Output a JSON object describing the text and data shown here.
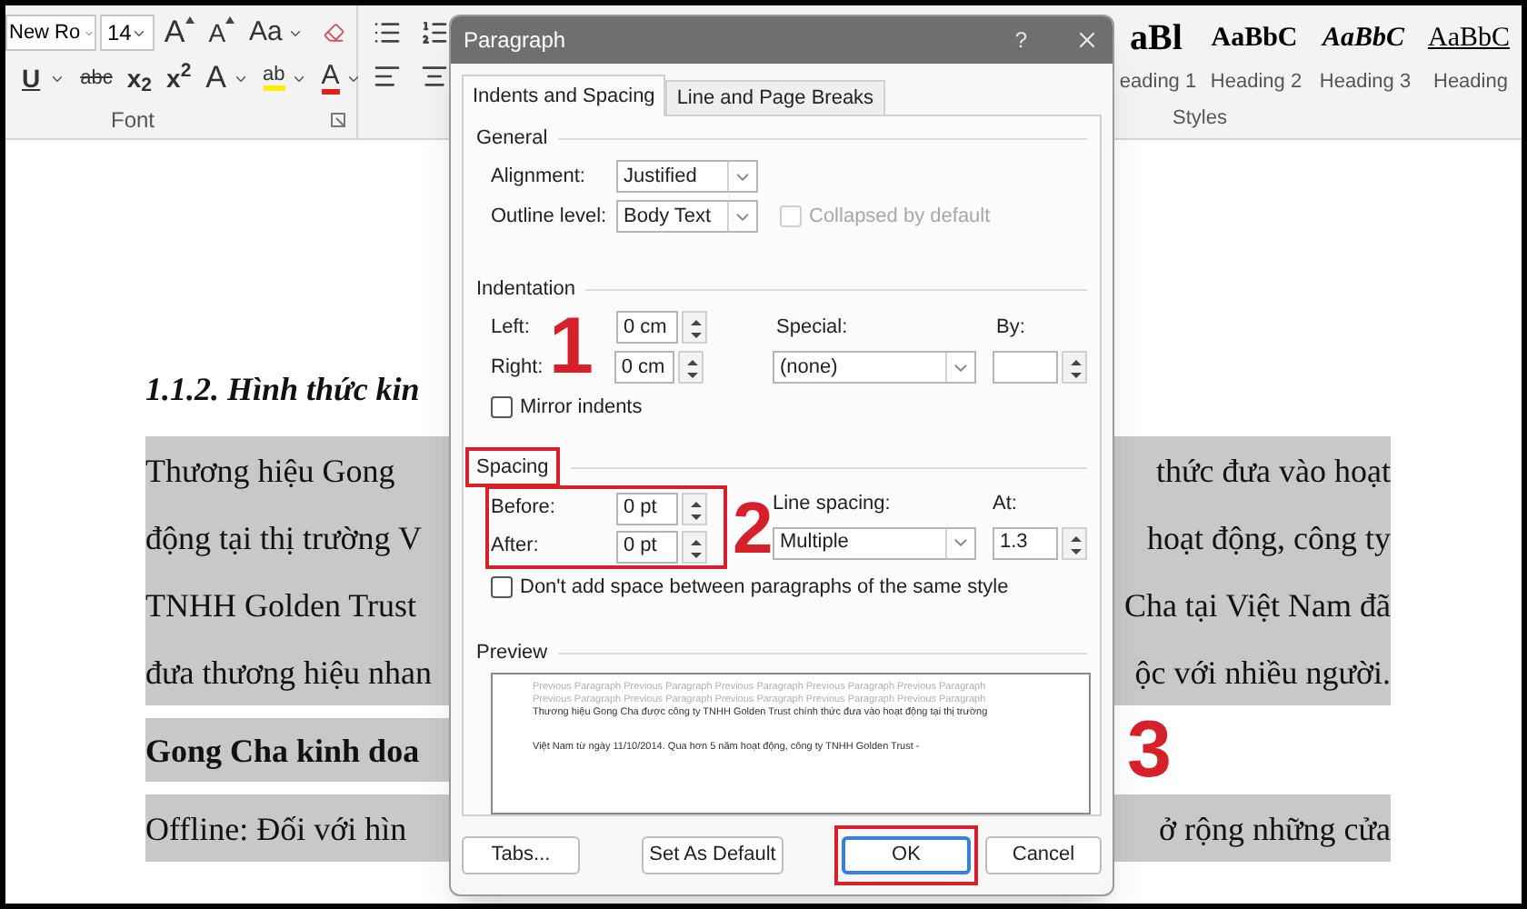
{
  "ribbon": {
    "font_name": "New Ro",
    "font_size": "14",
    "top_buttons": [
      {
        "kind": "grow",
        "label": "A"
      },
      {
        "kind": "shrink",
        "label": "A"
      },
      {
        "kind": "case",
        "label": "Aa"
      },
      {
        "kind": "clear"
      }
    ],
    "bottom_buttons": [
      {
        "kind": "underline",
        "label": "U"
      },
      {
        "kind": "strike",
        "label": "abc"
      },
      {
        "kind": "subscript",
        "label": "x$_{2}$"
      },
      {
        "kind": "superscript",
        "label": "x$^{2}$"
      },
      {
        "kind": "effects",
        "label": "A"
      },
      {
        "kind": "highlight",
        "label": "ab"
      },
      {
        "kind": "color",
        "label": "A"
      }
    ],
    "font_group_label": "Font",
    "styles": [
      {
        "kind": "heading1",
        "sample": "aBl",
        "label": "eading 1"
      },
      {
        "kind": "heading2",
        "sample": "AaBbC",
        "label": "Heading 2"
      },
      {
        "kind": "heading3",
        "sample": "AaBbC",
        "label": "Heading 3"
      },
      {
        "kind": "heading4",
        "sample": "AaBbC",
        "label": "Heading"
      }
    ],
    "styles_group_label": "Styles"
  },
  "document": {
    "lines": [
      {
        "kind": "heading",
        "left": "1.1.2. Hình thức kin",
        "highlighted": false
      },
      {
        "kind": "body",
        "left": "Thương hiệu Gong",
        "right": "thức đưa vào hoạt",
        "highlighted": true
      },
      {
        "kind": "body",
        "left": "động tại thị trường V",
        "right": "hoạt động, công ty",
        "highlighted": true
      },
      {
        "kind": "body",
        "left": "TNHH Golden Trust",
        "right": "Cha tại Việt Nam đã",
        "highlighted": true
      },
      {
        "kind": "body",
        "left": "đưa thương hiệu nhan",
        "right": "ộc với nhiều người.",
        "highlighted": true
      },
      {
        "kind": "bold",
        "left": "Gong Cha kinh doa",
        "highlighted": true
      },
      {
        "kind": "body",
        "left": "Offline: Đối với hìn",
        "right": "ở rộng những cửa",
        "highlighted": true
      }
    ]
  },
  "dialog": {
    "title": "Paragraph",
    "help": "?",
    "tabs": [
      {
        "label": "Indents and Spacing",
        "selected": true
      },
      {
        "label": "Line and Page Breaks",
        "selected": false
      }
    ],
    "general": {
      "heading": "General",
      "alignment": {
        "label": "Alignment:",
        "value": "Justified"
      },
      "outline_level": {
        "label": "Outline level:",
        "value": "Body Text"
      },
      "collapsed": {
        "label": "Collapsed by default",
        "checked": false,
        "disabled": true
      }
    },
    "indentation": {
      "heading": "Indentation",
      "left": {
        "label": "Left:",
        "value": "0 cm"
      },
      "right": {
        "label": "Right:",
        "value": "0 cm"
      },
      "special": {
        "label": "Special:",
        "value": "(none)"
      },
      "by": {
        "label": "By:"
      },
      "mirror": {
        "label": "Mirror indents",
        "checked": false
      }
    },
    "spacing": {
      "heading": "Spacing",
      "heading_framed": true,
      "before_after_framed": true,
      "before": {
        "label": "Before:",
        "value": "0 pt"
      },
      "after": {
        "label": "After:",
        "value": "0 pt"
      },
      "line_spacing": {
        "label": "Line spacing:",
        "value": "Multiple"
      },
      "at": {
        "label": "At:",
        "value": "1.3"
      },
      "dont_add": {
        "label": "Don't add space between paragraphs of the same style",
        "checked": false
      }
    },
    "preview": {
      "heading": "Preview",
      "previous_lines": [
        "Previous Paragraph Previous Paragraph Previous Paragraph Previous Paragraph Previous Paragraph",
        "Previous Paragraph Previous Paragraph Previous Paragraph Previous Paragraph Previous Paragraph"
      ],
      "sample_lines": [
        "Thương hiệu Gong Cha được công ty TNHH Golden Trust chính thức đưa vào hoạt động tại thị trường",
        "Việt Nam từ ngày 11/10/2014. Qua hơn 5 năm hoạt động, công ty TNHH Golden Trust -"
      ]
    },
    "buttons": [
      {
        "label": "Tabs...",
        "default": false,
        "framed": false
      },
      {
        "label": "Set As Default",
        "default": false,
        "framed": false
      },
      {
        "label": "OK",
        "default": true,
        "framed": true
      },
      {
        "label": "Cancel",
        "default": false,
        "framed": false
      }
    ]
  },
  "annotations": [
    {
      "label": "1"
    },
    {
      "label": "2"
    },
    {
      "label": "3"
    }
  ]
}
